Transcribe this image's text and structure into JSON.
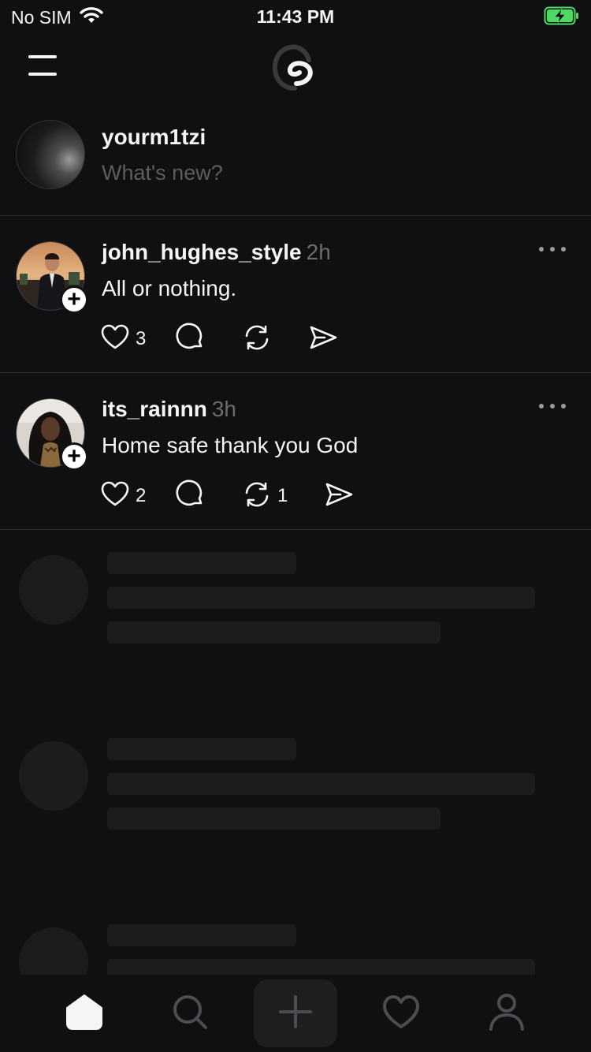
{
  "status_bar": {
    "carrier": "No SIM",
    "time": "11:43 PM",
    "wifi_icon": "wifi-icon",
    "battery_icon": "battery-charging-icon",
    "battery_color": "#4cd964"
  },
  "header": {
    "menu_icon": "menu-icon",
    "logo_icon": "threads-logo-icon"
  },
  "composer": {
    "username": "yourm1tzi",
    "placeholder": "What's new?"
  },
  "posts": [
    {
      "username": "john_hughes_style",
      "time": "2h",
      "text": "All or nothing.",
      "like_count": "3",
      "reply_count": "",
      "repost_count": "",
      "avatar_icon": "avatar-photo"
    },
    {
      "username": "its_rainnn",
      "time": "3h",
      "text": "Home safe thank you God",
      "like_count": "2",
      "reply_count": "",
      "repost_count": "1",
      "avatar_icon": "avatar-photo"
    }
  ],
  "tab_bar": {
    "tabs": [
      "home-icon",
      "search-icon",
      "create-icon",
      "activity-icon",
      "profile-icon"
    ],
    "active": "home-icon"
  },
  "colors": {
    "background": "#101012",
    "text": "#f3f5f7",
    "secondary_text": "#6b6b70",
    "skeleton": "#1c1c1e"
  }
}
